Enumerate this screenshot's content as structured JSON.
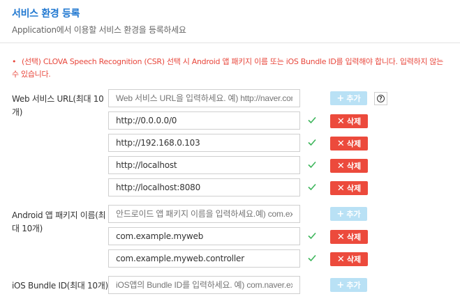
{
  "header": {
    "title": "서비스 환경 등록",
    "subtitle": "Application에서 이용할 서비스 환경을 등록하세요"
  },
  "notice": {
    "bullet": "•",
    "line1": "(선택) CLOVA Speech Recognition (CSR) 선택 시 Android 앱 패키지 이름 또는 iOS Bundle ID를 입력해야 합니다. 입력하지 않는",
    "line2": "수 있습니다."
  },
  "web": {
    "label_line1": "Web 서비스 URL(최대 10",
    "label_line2": "개)",
    "placeholder": "Web 서비스 URL을 입력하세요. 예) http://naver.com",
    "entries": [
      "http://0.0.0.0/0",
      "http://192.168.0.103",
      "http://localhost",
      "http://localhost:8080"
    ]
  },
  "android": {
    "label_line1": "Android 앱 패키지 이름(최",
    "label_line2": "대 10개)",
    "placeholder": "안드로이드 앱 패키지 이름을 입력하세요.예) com.example",
    "entries": [
      "com.example.myweb",
      "com.example.myweb.controller"
    ]
  },
  "ios": {
    "label": "iOS Bundle ID(최대 10개)",
    "placeholder": "iOS앱의 Bundle ID를 입력하세요. 예) com.naver.example"
  },
  "buttons": {
    "add_label": "추가",
    "add_glyph": "+",
    "delete_label": "삭제",
    "delete_glyph": "✕",
    "help_glyph": "?"
  },
  "colors": {
    "title": "#1f77d0",
    "notice": "#e8473c",
    "add_button": "#b9e1f5",
    "delete_button": "#ec4a3c",
    "check": "#3cb55a"
  },
  "icons": {
    "check": "check-icon",
    "help": "question-circle-icon",
    "add": "plus-icon",
    "delete": "x-icon"
  }
}
